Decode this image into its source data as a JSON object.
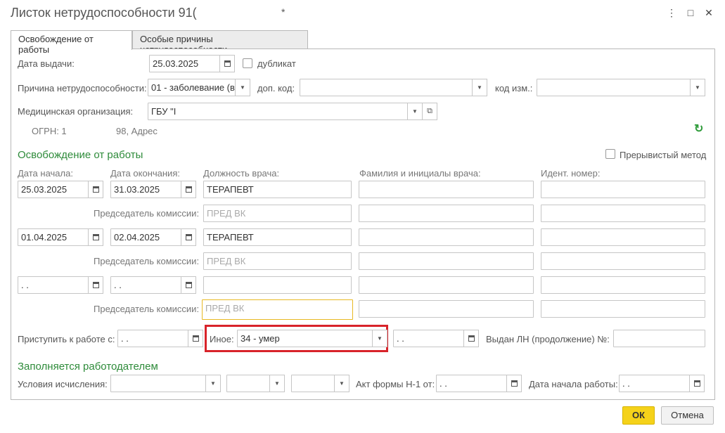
{
  "window": {
    "title": "Листок нетрудоспособности 91(",
    "star": "*",
    "menu_icon": "⋮",
    "maximize_icon": "□",
    "close_icon": "✕"
  },
  "tabs": [
    "Освобождение от работы",
    "Особые причины нетрудоспособности"
  ],
  "issue": {
    "label": "Дата выдачи:",
    "date": "25.03.2025",
    "duplicate_label": "дубликат"
  },
  "reason": {
    "label": "Причина нетрудоспособности:",
    "value": "01 - заболевание (в",
    "dop_label": "доп. код:",
    "dop_value": "",
    "izm_label": "код изм.:",
    "izm_value": ""
  },
  "med_org": {
    "label": "Медицинская организация:",
    "value": "ГБУ \"І",
    "ogrn_label": "ОГРН: 1",
    "ogrn_value": "98, Адрес"
  },
  "release": {
    "section_title": "Освобождение от работы",
    "intermittent_label": "Прерывистый метод",
    "col_start": "Дата начала:",
    "col_end": "Дата окончания:",
    "col_position": "Должность врача:",
    "col_name": "Фамилия и инициалы врача:",
    "col_id": "Идент.  номер:",
    "chairman_label": "Председатель комиссии:",
    "rows": [
      {
        "start": "25.03.2025",
        "end": "31.03.2025",
        "position": "ТЕРАПЕВТ",
        "name": "",
        "id": "",
        "chairman_ph": "ПРЕД ВК"
      },
      {
        "start": "01.04.2025",
        "end": "02.04.2025",
        "position": "ТЕРАПЕВТ",
        "name": "",
        "id": "",
        "chairman_ph": "ПРЕД ВК"
      },
      {
        "start": " .  .",
        "end": " .  .",
        "position": "",
        "name": "",
        "id": "",
        "chairman_ph": "ПРЕД ВК"
      }
    ]
  },
  "return_work": {
    "label": "Приступить к работе с:",
    "date": " .  .",
    "other_label": "Иное:",
    "other_value": "34 - умер",
    "other_date": " .  .",
    "continued_label": "Выдан ЛН (продолжение) №:",
    "continued_value": ""
  },
  "employer": {
    "section_title": "Заполняется работодателем",
    "conditions_label": "Условия исчисления:",
    "act_label": "Акт формы Н-1 от:",
    "act_date": " .  .",
    "start_label": "Дата начала работы:",
    "start_date": " .  ."
  },
  "footer": {
    "ok": "ОК",
    "cancel": "Отмена"
  }
}
